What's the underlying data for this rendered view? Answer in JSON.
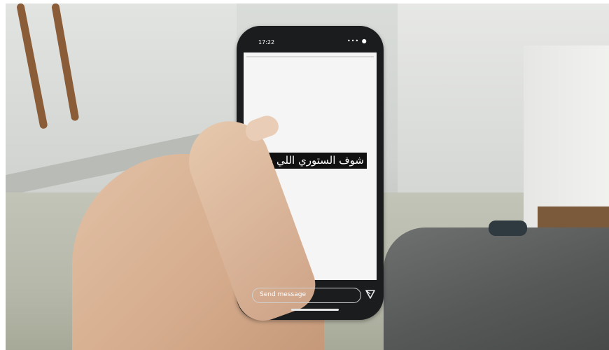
{
  "photo": {
    "phone": {
      "status_time": "17:22",
      "status_icons": "••• ●",
      "story_text": "شوف الستوري اللي بعد",
      "message_placeholder": "Send message"
    }
  }
}
